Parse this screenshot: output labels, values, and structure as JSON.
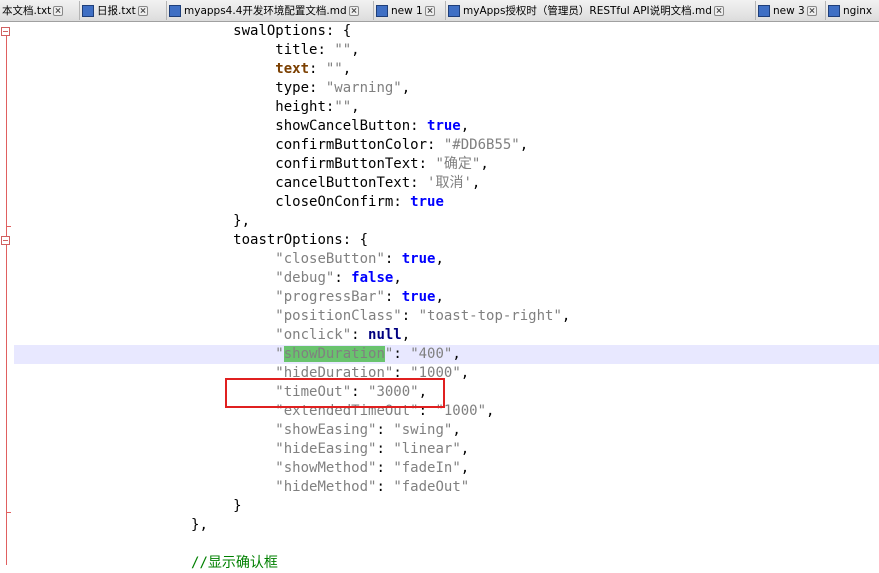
{
  "tabs": [
    {
      "label": "本文档.txt",
      "icon": "save-blue"
    },
    {
      "label": "日报.txt",
      "icon": "save-blue"
    },
    {
      "label": "myapps4.4开发环境配置文档.md",
      "icon": "save-blue"
    },
    {
      "label": "new 1",
      "icon": "save-blue"
    },
    {
      "label": "myApps授权时（管理员）RESTful API说明文档.md",
      "icon": "save-blue"
    },
    {
      "label": "new 3",
      "icon": "save-blue"
    },
    {
      "label": "nginx",
      "icon": "save-blue"
    }
  ],
  "code": {
    "l1_key": "swalOptions",
    "l1_rest": ": {",
    "title_key": "title",
    "title_val": "\"\"",
    "text_key": "text",
    "text_val": "\"\"",
    "type_key": "type",
    "type_val": "\"warning\"",
    "height_key": "height",
    "height_val": "\"\"",
    "scb_key": "showCancelButton",
    "scb_val": "true",
    "cbc_key": "confirmButtonColor",
    "cbc_val": "\"#DD6B55\"",
    "cbt_key": "confirmButtonText",
    "cbt_val": "\"确定\"",
    "cnt_key": "cancelButtonText",
    "cnt_val": "'取消'",
    "coc_key": "closeOnConfirm",
    "coc_val": "true",
    "close1": "},",
    "t_key": "toastrOptions",
    "t_rest": ": {",
    "cb_key": "\"closeButton\"",
    "cb_val": "true",
    "dbg_key": "\"debug\"",
    "dbg_val": "false",
    "pb_key": "\"progressBar\"",
    "pb_val": "true",
    "pc_key": "\"positionClass\"",
    "pc_val": "\"toast-top-right\"",
    "oc_key": "\"onclick\"",
    "oc_val": "null",
    "sd_q1": "\"",
    "sd_word": "showDuration",
    "sd_q2": "\"",
    "sd_val": "\"400\"",
    "hd_key": "\"hideDuration\"",
    "hd_val": "\"1000\"",
    "to_key": "\"timeOut\"",
    "to_val": "\"3000\"",
    "eto_key": "\"extendedTimeOut\"",
    "eto_val": "\"1000\"",
    "se_key": "\"showEasing\"",
    "se_val": "\"swing\"",
    "he_key": "\"hideEasing\"",
    "he_val": "\"linear\"",
    "sm_key": "\"showMethod\"",
    "sm_val": "\"fadeIn\"",
    "hm_key": "\"hideMethod\"",
    "hm_val": "\"fadeOut\"",
    "close2": "}",
    "close3": "},",
    "comment": "//显示确认框"
  }
}
